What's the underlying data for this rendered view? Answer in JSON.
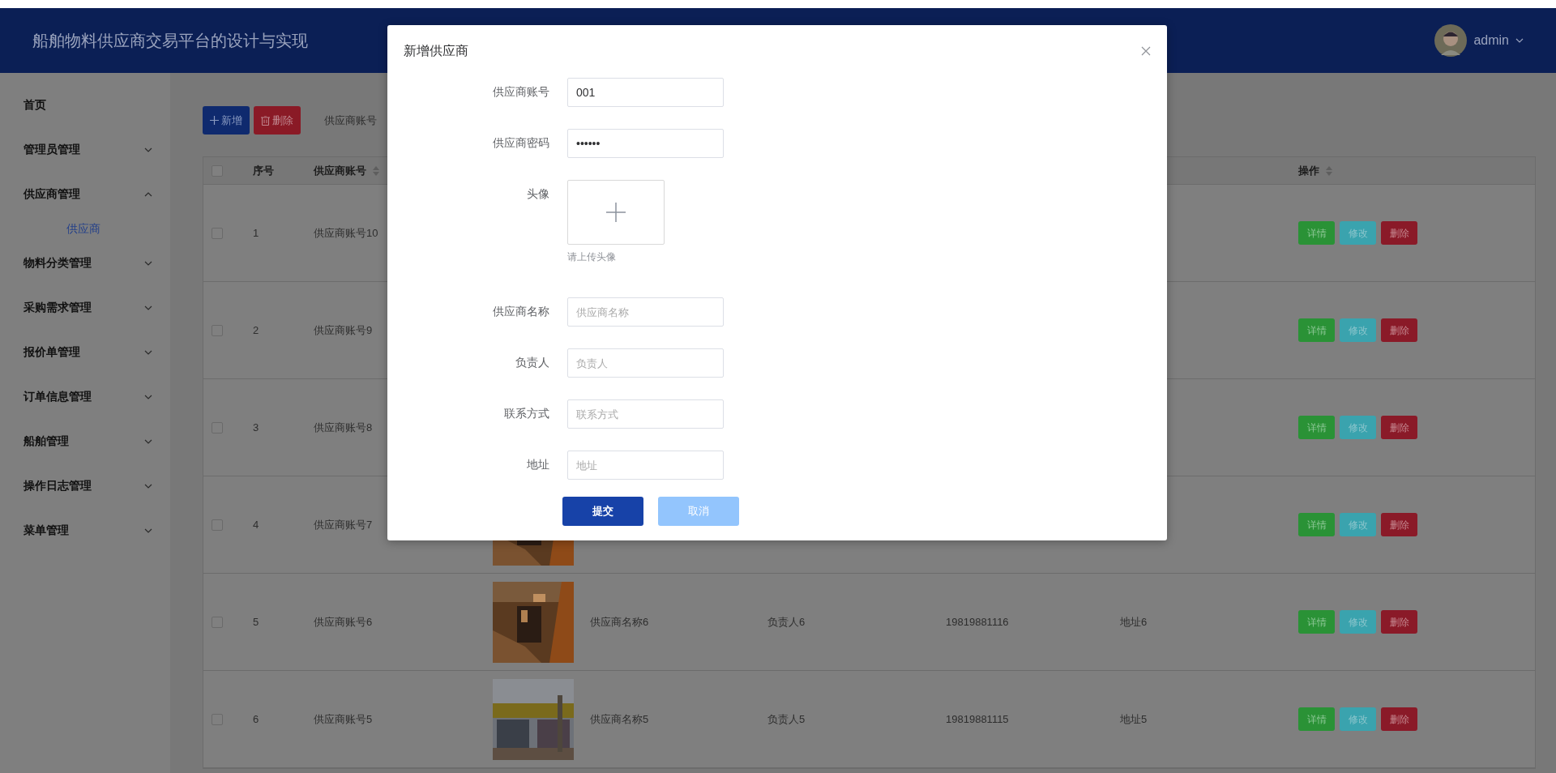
{
  "header": {
    "title": "船舶物料供应商交易平台的设计与实现",
    "user": "admin"
  },
  "sidebar": {
    "items": [
      {
        "label": "首页",
        "kind": "link"
      },
      {
        "label": "管理员管理",
        "kind": "group",
        "expanded": false
      },
      {
        "label": "供应商管理",
        "kind": "group",
        "expanded": true,
        "children": [
          {
            "label": "供应商",
            "selected": true
          }
        ]
      },
      {
        "label": "物料分类管理",
        "kind": "group",
        "expanded": false
      },
      {
        "label": "采购需求管理",
        "kind": "group",
        "expanded": false
      },
      {
        "label": "报价单管理",
        "kind": "group",
        "expanded": false
      },
      {
        "label": "订单信息管理",
        "kind": "group",
        "expanded": false
      },
      {
        "label": "船舶管理",
        "kind": "group",
        "expanded": false
      },
      {
        "label": "操作日志管理",
        "kind": "group",
        "expanded": false
      },
      {
        "label": "菜单管理",
        "kind": "group",
        "expanded": false
      }
    ]
  },
  "toolbar": {
    "buttons": [
      {
        "label": "新增",
        "kind": "add"
      },
      {
        "label": "删除",
        "kind": "delete"
      }
    ],
    "search_label": "供应商账号"
  },
  "table": {
    "select_all": {
      "checked": false
    },
    "columns": [
      {
        "kind": "index",
        "label": "序号",
        "sortable": false
      },
      {
        "kind": "account",
        "label": "供应商账号",
        "sortable": true
      },
      {
        "kind": "actions",
        "label": "操作",
        "sortable": true
      }
    ],
    "rows": [
      {
        "checked": false,
        "index": "1",
        "account": "供应商账号10",
        "actions": [
          {
            "label": "详情",
            "kind": "detail"
          },
          {
            "label": "修改",
            "kind": "edit"
          },
          {
            "label": "删除",
            "kind": "delete"
          }
        ]
      },
      {
        "checked": false,
        "index": "2",
        "account": "供应商账号9",
        "actions": [
          {
            "label": "详情",
            "kind": "detail"
          },
          {
            "label": "修改",
            "kind": "edit"
          },
          {
            "label": "删除",
            "kind": "delete"
          }
        ]
      },
      {
        "checked": false,
        "index": "3",
        "account": "供应商账号8",
        "actions": [
          {
            "label": "详情",
            "kind": "detail"
          },
          {
            "label": "修改",
            "kind": "edit"
          },
          {
            "label": "删除",
            "kind": "delete"
          }
        ]
      },
      {
        "checked": false,
        "index": "4",
        "account": "供应商账号7",
        "actions": [
          {
            "label": "详情",
            "kind": "detail"
          },
          {
            "label": "修改",
            "kind": "edit"
          },
          {
            "label": "删除",
            "kind": "delete"
          }
        ]
      },
      {
        "checked": false,
        "index": "5",
        "account": "供应商账号6",
        "name": "供应商名称6",
        "person": "负责人6",
        "phone": "19819881116",
        "address": "地址6",
        "actions": [
          {
            "label": "详情",
            "kind": "detail"
          },
          {
            "label": "修改",
            "kind": "edit"
          },
          {
            "label": "删除",
            "kind": "delete"
          }
        ]
      },
      {
        "checked": false,
        "index": "6",
        "account": "供应商账号5",
        "name": "供应商名称5",
        "person": "负责人5",
        "phone": "19819881115",
        "address": "地址5",
        "actions": [
          {
            "label": "详情",
            "kind": "detail"
          },
          {
            "label": "修改",
            "kind": "edit"
          },
          {
            "label": "删除",
            "kind": "delete"
          }
        ]
      }
    ]
  },
  "dialog": {
    "title": "新增供应商",
    "fields": [
      {
        "label": "供应商账号",
        "kind": "text",
        "value": "001"
      },
      {
        "label": "供应商密码",
        "kind": "text",
        "value": "••••••"
      },
      {
        "label": "头像",
        "kind": "upload",
        "hint": "请上传头像"
      },
      {
        "label": "供应商名称",
        "kind": "text",
        "placeholder": "供应商名称"
      },
      {
        "label": "负责人",
        "kind": "text",
        "placeholder": "负责人"
      },
      {
        "label": "联系方式",
        "kind": "text",
        "placeholder": "联系方式"
      },
      {
        "label": "地址",
        "kind": "text",
        "placeholder": "地址"
      }
    ],
    "buttons": [
      {
        "label": "提交",
        "kind": "primary"
      },
      {
        "label": "取消",
        "kind": "cancel"
      }
    ]
  }
}
